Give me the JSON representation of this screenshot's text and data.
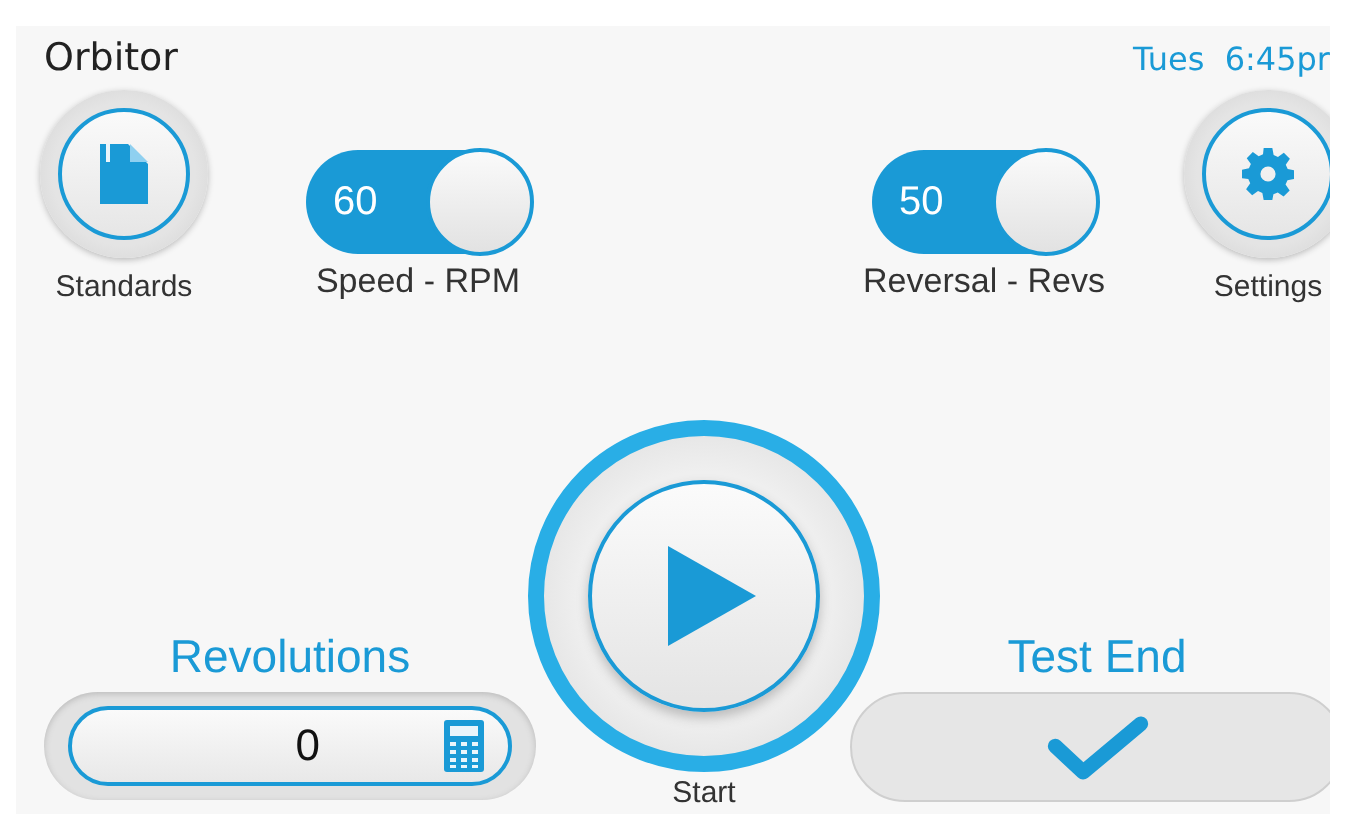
{
  "header": {
    "title": "Orbitor",
    "time": "Tues  6:45pr"
  },
  "round_buttons": [
    {
      "kind": "document",
      "label": "Standards"
    },
    {
      "kind": "gear",
      "label": "Settings"
    }
  ],
  "toggles": [
    {
      "value": "60",
      "label": "Speed - RPM",
      "on": true
    },
    {
      "value": "50",
      "label": "Reversal - Revs",
      "on": true
    }
  ],
  "revolutions": {
    "label": "Revolutions",
    "value": "0"
  },
  "start": {
    "label": "Start"
  },
  "test_end": {
    "label": "Test End"
  }
}
